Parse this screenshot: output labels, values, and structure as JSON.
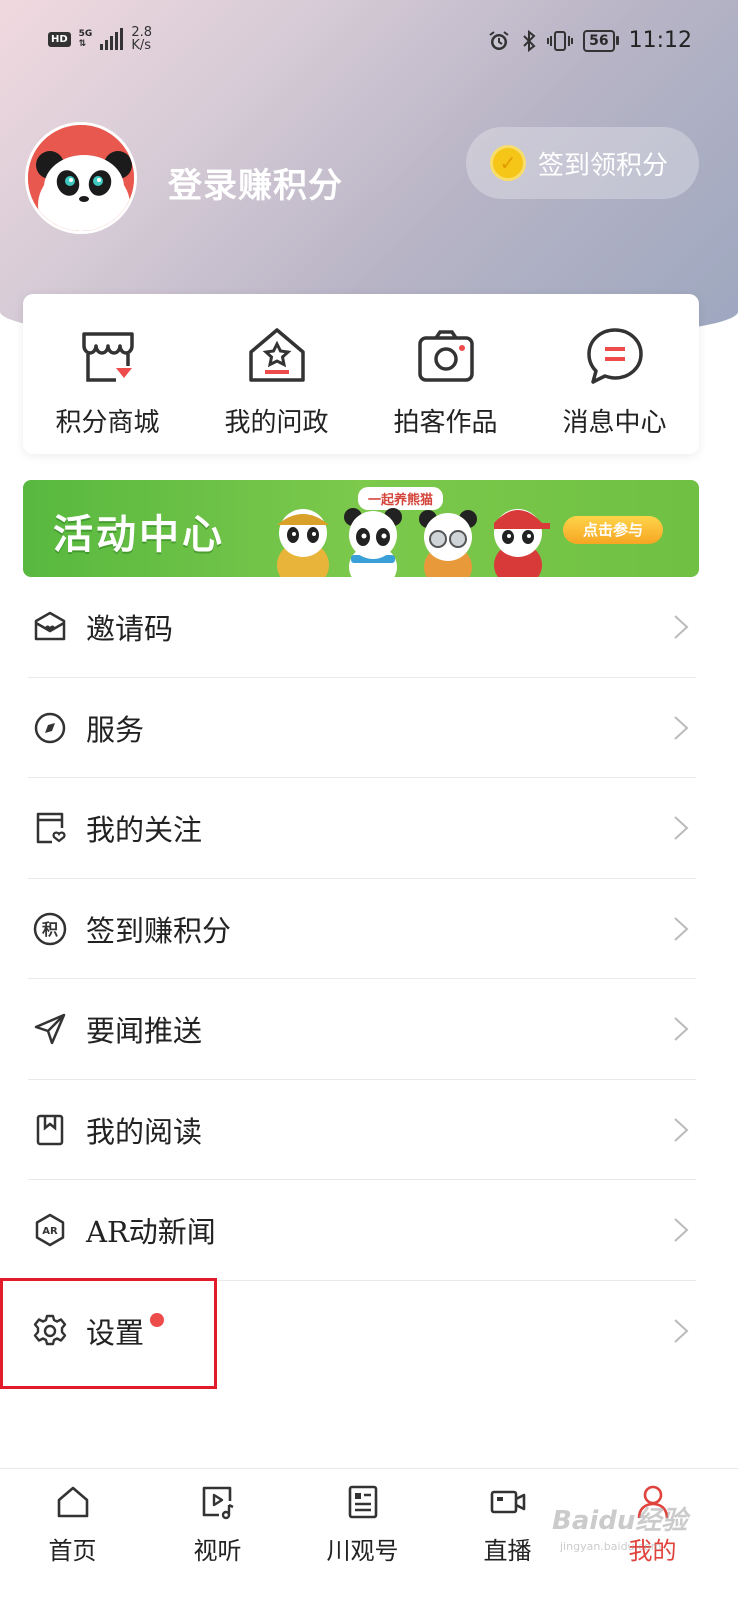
{
  "status_bar": {
    "hd_badge": "HD",
    "network_type": "5G",
    "net_speed_value": "2.8",
    "net_speed_unit": "K/s",
    "battery": "56",
    "time": "11:12"
  },
  "profile": {
    "login_prompt": "登录赚积分",
    "checkin_button": "签到领积分"
  },
  "quick_access": [
    {
      "label": "积分商城",
      "icon": "store-icon"
    },
    {
      "label": "我的问政",
      "icon": "house-star-icon"
    },
    {
      "label": "拍客作品",
      "icon": "camera-icon"
    },
    {
      "label": "消息中心",
      "icon": "chat-bubble-icon"
    }
  ],
  "banner": {
    "title": "活动中心",
    "tag": "一起养熊猫",
    "cta": "点击参与"
  },
  "menu": [
    {
      "label": "邀请码",
      "icon": "envelope-heart-icon"
    },
    {
      "label": "服务",
      "icon": "compass-icon"
    },
    {
      "label": "我的关注",
      "icon": "follow-card-icon"
    },
    {
      "label": "签到赚积分",
      "icon": "points-icon",
      "icon_text": "积"
    },
    {
      "label": "要闻推送",
      "icon": "send-icon"
    },
    {
      "label": "我的阅读",
      "icon": "bookmark-book-icon"
    },
    {
      "label": "AR动新闻",
      "icon": "ar-icon",
      "icon_text": "AR"
    },
    {
      "label": "设置",
      "icon": "gear-icon",
      "has_badge": true
    }
  ],
  "bottom_nav": [
    {
      "label": "首页",
      "icon": "home-icon",
      "active": false
    },
    {
      "label": "视听",
      "icon": "media-icon",
      "active": false
    },
    {
      "label": "川观号",
      "icon": "profile-card-icon",
      "active": false
    },
    {
      "label": "直播",
      "icon": "video-camera-icon",
      "active": false
    },
    {
      "label": "我的",
      "icon": "user-icon",
      "active": true
    }
  ],
  "watermark": {
    "brand": "Baidu经验",
    "url": "jingyan.baidu.com"
  },
  "colors": {
    "accent_red": "#e0433c",
    "badge_red": "#ee4b4b",
    "banner_green": "#6fc043",
    "highlight_border": "#e21b2a"
  }
}
